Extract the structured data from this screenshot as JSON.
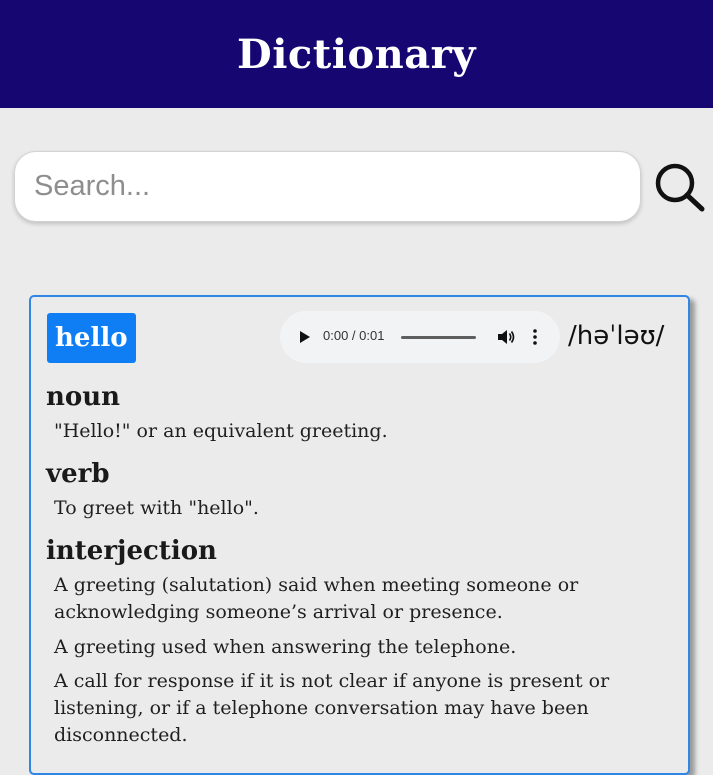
{
  "header": {
    "title": "Dictionary"
  },
  "search": {
    "placeholder": "Search...",
    "value": ""
  },
  "entry": {
    "word": "hello",
    "phonetic": "/həˈləʊ/",
    "audio": {
      "time": "0:00 / 0:01"
    },
    "meanings": [
      {
        "part_of_speech": "noun",
        "definitions": [
          "\"Hello!\" or an equivalent greeting."
        ]
      },
      {
        "part_of_speech": "verb",
        "definitions": [
          "To greet with \"hello\"."
        ]
      },
      {
        "part_of_speech": "interjection",
        "definitions": [
          "A greeting (salutation) said when meeting someone or acknowledging someone’s arrival or presence.",
          "A greeting used when answering the telephone.",
          "A call for response if it is not clear if anyone is present or listening, or if a telephone conversation may have been disconnected."
        ]
      }
    ]
  },
  "colors": {
    "header_bg": "#150671",
    "badge_bg": "#0f7ef5",
    "card_border": "#2f86e4",
    "page_bg": "#ebebec"
  }
}
